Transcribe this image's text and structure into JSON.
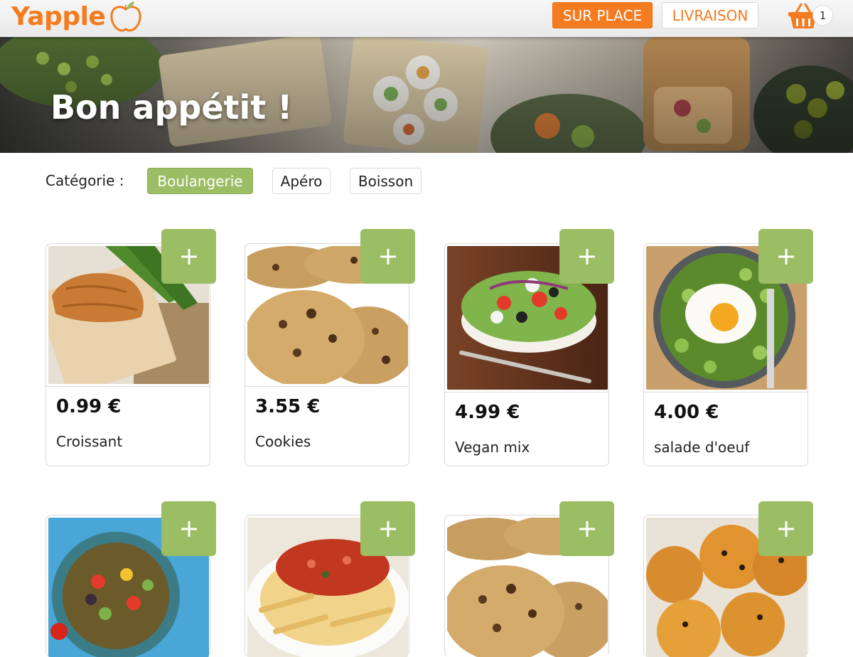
{
  "header": {
    "brand": "Yapple",
    "sur_place": "SUR PLACE",
    "livraison": "LIVRAISON",
    "basket_count": "1"
  },
  "hero": {
    "title": "Bon appétit !"
  },
  "categories": {
    "label": "Catégorie :",
    "items": [
      "Boulangerie",
      "Apéro",
      "Boisson"
    ],
    "active": "Boulangerie"
  },
  "products": [
    {
      "price": "0.99 €",
      "name": "Croissant"
    },
    {
      "price": "3.55 €",
      "name": "Cookies"
    },
    {
      "price": "4.99 €",
      "name": "Vegan mix"
    },
    {
      "price": "4.00 €",
      "name": "salade d'oeuf"
    }
  ],
  "colors": {
    "brand": "#f47b20",
    "accent_green": "#9bbd63"
  }
}
